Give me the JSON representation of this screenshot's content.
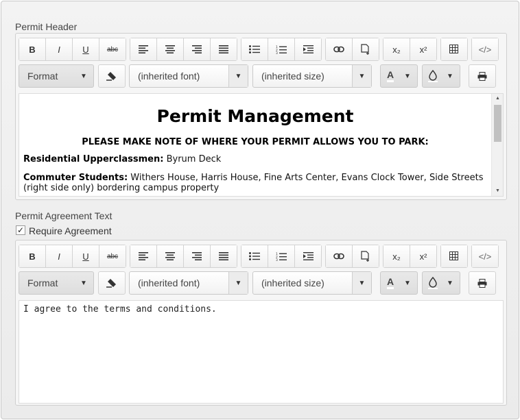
{
  "editor1": {
    "label": "Permit Header",
    "format_label": "Format",
    "font_value": "(inherited font)",
    "size_value": "(inherited size)",
    "doc": {
      "title": "Permit Management",
      "note": "PLEASE MAKE NOTE OF WHERE YOUR PERMIT ALLOWS YOU TO PARK:",
      "line1_bold": "Residential Upperclassmen:",
      "line1_text": " Byrum Deck",
      "line2_bold": "Commuter Students:",
      "line2_text": " Withers House, Harris House, Fine Arts Center, Evans Clock Tower, Side Streets (right side only) bordering campus property"
    }
  },
  "agreement": {
    "label": "Permit Agreement Text",
    "checkbox_label": "Require Agreement",
    "checked": true
  },
  "editor2": {
    "format_label": "Format",
    "font_value": "(inherited font)",
    "size_value": "(inherited size)",
    "content": "I agree to the terms and conditions."
  },
  "toolbar": {
    "bold": "B",
    "italic": "I",
    "underline": "U",
    "strike": "abc",
    "subscript": "x₂",
    "superscript": "x²",
    "code": "</>",
    "text_color": "A"
  },
  "icons": [
    "bold-icon",
    "italic-icon",
    "underline-icon",
    "strikethrough-icon",
    "align-left-icon",
    "align-center-icon",
    "align-right-icon",
    "justify-icon",
    "bullet-list-icon",
    "numbered-list-icon",
    "indent-icon",
    "link-icon",
    "insert-file-icon",
    "subscript-icon",
    "superscript-icon",
    "table-icon",
    "code-view-icon",
    "clear-format-icon",
    "text-color-icon",
    "background-color-icon",
    "print-icon"
  ]
}
